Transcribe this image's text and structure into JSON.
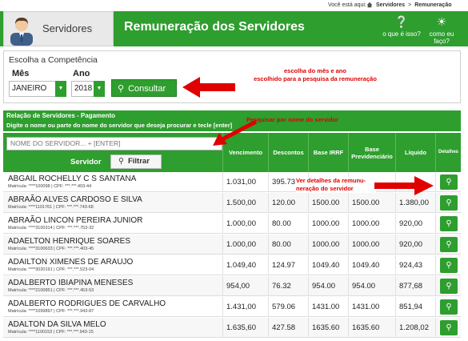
{
  "crumbs": {
    "you_are_here": "Você está aqui:",
    "level1": "Servidores",
    "sep": ">",
    "level2": "Remuneração"
  },
  "header": {
    "brand": "Servidores",
    "title": "Remuneração dos Servidores",
    "what_is": "o que é isso?",
    "how_to": "como eu faço?",
    "accent": "#2e9e2e"
  },
  "competencia": {
    "heading": "Escolha a Competência",
    "mes_label": "Mês",
    "mes_value": "JANEIRO",
    "ano_label": "Ano",
    "ano_value": "2018",
    "consultar_label": "Consultar",
    "annotation_line1": "escolha do mês e ano",
    "annotation_line2": "escolhido para a pesquisa da remuneração"
  },
  "relacao": {
    "title": "Relação de Servidores - Pagamento",
    "subtitle": "Digite o nome ou parte do nome do servidor que deseja procurar e tecle [enter]",
    "annotation": "Pesquisar por nome do servidor"
  },
  "table": {
    "search_placeholder": "NOME DO SERVIDOR... + [ENTER]",
    "servidor_label": "Servidor",
    "filtrar_label": "Filtrar",
    "headers": {
      "vencimento": "Vencimento",
      "descontos": "Descontos",
      "irrf": "Base IRRF",
      "prev": "Base Previdenciário",
      "liquido": "Líquido",
      "detalhes": "Detalhes"
    },
    "annotation_line1": "Ver detalhes da remunu-",
    "annotation_line2": "neração do servidor",
    "rows": [
      {
        "name": "ABGAIL ROCHELLY C S SANTANA",
        "meta": "Matrícula: ****100098 | CPF: ***.***.403-44",
        "venc": "1.031,00",
        "desc": "395.73",
        "irrf": "",
        "prev": "",
        "liq": ""
      },
      {
        "name": "ABRAÃO ALVES CARDOSO E SILVA",
        "meta": "Matrícula: ****1101761 | CPF: ***.***.743-68",
        "venc": "1.500,00",
        "desc": "120.00",
        "irrf": "1500.00",
        "prev": "1500.00",
        "liq": "1.380,00"
      },
      {
        "name": "ABRAÃO LINCON PEREIRA JUNIOR",
        "meta": "Matrícula: ****3100314 | CPF: ***.***.753-32",
        "venc": "1.000,00",
        "desc": "80.00",
        "irrf": "1000.00",
        "prev": "1000.00",
        "liq": "920,00"
      },
      {
        "name": "ADAELTON HENRIQUE SOARES",
        "meta": "Matrícula: ****3100633 | CPF: ***.***.403-45",
        "venc": "1.000,00",
        "desc": "80.00",
        "irrf": "1000.00",
        "prev": "1000.00",
        "liq": "920,00"
      },
      {
        "name": "ADAILTON XIMENES DE ARAUJO",
        "meta": "Matrícula: ****3020191 | CPF: ***.***.523-04",
        "venc": "1.049,40",
        "desc": "124.97",
        "irrf": "1049.40",
        "prev": "1049.40",
        "liq": "924,43"
      },
      {
        "name": "ADALBERTO IBIAPINA MENESES",
        "meta": "Matrícula: ****2100851 | CPF: ***.***.453-53",
        "venc": "954,00",
        "desc": "76.32",
        "irrf": "954.00",
        "prev": "954.00",
        "liq": "877,68"
      },
      {
        "name": "ADALBERTO RODRIGUES DE CARVALHO",
        "meta": "Matrícula: ****1099897 | CPF: ***.***.943-87",
        "venc": "1.431,00",
        "desc": "579.06",
        "irrf": "1431.00",
        "prev": "1431.00",
        "liq": "851,94"
      },
      {
        "name": "ADALTON DA SILVA MELO",
        "meta": "Matrícula: ****1100153 | CPF: ***.***.943-15",
        "venc": "1.635,60",
        "desc": "427.58",
        "irrf": "1635.60",
        "prev": "1635.60",
        "liq": "1.208,02"
      }
    ]
  }
}
